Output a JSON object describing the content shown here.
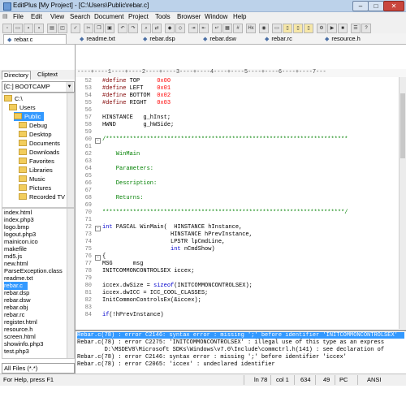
{
  "window": {
    "title": "EditPlus [My Project] - [C:\\Users\\Public\\rebar.c]",
    "minimize": "–",
    "maximize": "□",
    "close": "✕"
  },
  "menu": [
    "File",
    "Edit",
    "View",
    "Search",
    "Document",
    "Project",
    "Tools",
    "Browser",
    "Window",
    "Help"
  ],
  "toolbar": {
    "abc_label": "Hx"
  },
  "tabs": [
    "rebar.c",
    "readme.txt",
    "rebar.dsp",
    "rebar.dsw",
    "rebar.rc",
    "resource.h"
  ],
  "panel": {
    "tabs": [
      "Directory",
      "Cliptext"
    ],
    "drive": "[C:] BOOTCAMP",
    "tree": [
      "C:\\",
      "Users",
      "Public",
      "Debug",
      "Desktop",
      "Documents",
      "Downloads",
      "Favorites",
      "Libraries",
      "Music",
      "Pictures",
      "Recorded TV"
    ],
    "files": [
      "index.html",
      "index.php3",
      "logo.bmp",
      "logout.php3",
      "mainicon.ico",
      "makefile",
      "md5.js",
      "new.html",
      "ParseException.class",
      "readme.txt",
      "rebar.c",
      "rebar.dsp",
      "rebar.dsw",
      "rebar.obj",
      "rebar.rc",
      "register.html",
      "resource.h",
      "screen.html",
      "showinfo.php3",
      "test.php3"
    ],
    "filter": "All Files (*.*)"
  },
  "ruler": "----+----1----+----2----+----3----+----4----+----5----+----6----+----7---",
  "code_lines": [
    {
      "n": "52",
      "t": "#define TOP     0x00"
    },
    {
      "n": "53",
      "t": "#define LEFT    0x01"
    },
    {
      "n": "54",
      "t": "#define BOTTOM  0x02"
    },
    {
      "n": "55",
      "t": "#define RIGHT   0x03"
    },
    {
      "n": "56",
      "t": ""
    },
    {
      "n": "57",
      "t": "HINSTANCE   g_hInst;"
    },
    {
      "n": "58",
      "t": "HWND        g_hWSide;"
    },
    {
      "n": "59",
      "t": ""
    },
    {
      "n": "60",
      "t": "/***********************************************************************"
    },
    {
      "n": "61",
      "t": ""
    },
    {
      "n": "62",
      "t": "    WinMain"
    },
    {
      "n": "63",
      "t": ""
    },
    {
      "n": "64",
      "t": "    Parameters:"
    },
    {
      "n": "65",
      "t": ""
    },
    {
      "n": "66",
      "t": "    Description:"
    },
    {
      "n": "67",
      "t": ""
    },
    {
      "n": "68",
      "t": "    Returns:"
    },
    {
      "n": "69",
      "t": ""
    },
    {
      "n": "70",
      "t": "***********************************************************************/"
    },
    {
      "n": "71",
      "t": ""
    },
    {
      "n": "72",
      "t": "int PASCAL WinMain(  HINSTANCE hInstance,"
    },
    {
      "n": "73",
      "t": "                    HINSTANCE hPrevInstance,"
    },
    {
      "n": "74",
      "t": "                    LPSTR lpCmdLine,"
    },
    {
      "n": "75",
      "t": "                    int nCmdShow)"
    },
    {
      "n": "76",
      "t": "{"
    },
    {
      "n": "77",
      "t": "MSG      msg"
    },
    {
      "n": "78",
      "t": "INITCOMMONCONTROLSEX iccex;"
    },
    {
      "n": "79",
      "t": ""
    },
    {
      "n": "80",
      "t": "iccex.dwSize = sizeof(INITCOMMONCONTROLSEX);"
    },
    {
      "n": "81",
      "t": "iccex.dwICC = ICC_COOL_CLASSES;"
    },
    {
      "n": "82",
      "t": "InitCommonControlsEx(&iccex);"
    },
    {
      "n": "83",
      "t": ""
    },
    {
      "n": "84",
      "t": "if(!hPrevInstance)"
    }
  ],
  "output": [
    "Rebar.c(78) : error C2146: syntax error : missing ';' before identifier 'INITCOMMONCONTROLSEX'",
    "Rebar.c(78) : error C2275: 'INITCOMMONCONTROLSEX' : illegal use of this type as an express",
    "        D:\\MSDEV8\\Microsoft SDKs\\Windows\\v7.0\\Include\\commctrl.h(141) : see declaration of",
    "Rebar.c(78) : error C2146: syntax error : missing ';' before identifier 'iccex'",
    "Rebar.c(78) : error C2065: 'iccex' : undeclared identifier"
  ],
  "status": {
    "help": "For Help, press F1",
    "line": "ln 78",
    "col": "col 1",
    "total": "634",
    "num": "49",
    "mode": "PC",
    "encoding": "ANSI"
  }
}
